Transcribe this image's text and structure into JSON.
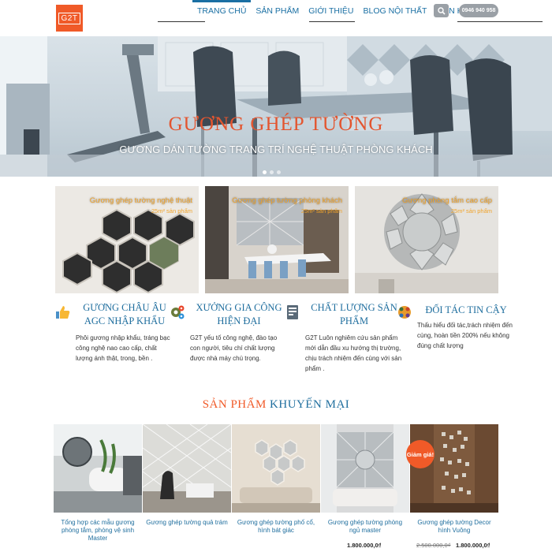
{
  "header": {
    "logo_text": "G2T",
    "nav": [
      {
        "label": "Trang chủ",
        "active": true
      },
      {
        "label": "Sản phẩm",
        "active": false
      },
      {
        "label": "Giới thiệu",
        "active": false
      },
      {
        "label": "Blog nội thất",
        "active": false
      },
      {
        "label": "Liên hệ",
        "active": false
      }
    ],
    "search_icon": "search-icon",
    "phone": "0946 940 958"
  },
  "hero": {
    "title": "GƯƠNG GHÉP TƯỜNG",
    "subtitle": "Gương dán tường trang trí nghệ thuật phòng khách",
    "slides": 3,
    "active_slide": 0
  },
  "tiles": [
    {
      "title": "Gương ghép tường nghệ thuật",
      "subtitle": "25m² sản phẩm"
    },
    {
      "title": "Gương ghép tường phòng khách",
      "subtitle": "25m² sản phẩm"
    },
    {
      "title": "Gương phòng tắm cao cấp",
      "subtitle": "25m² sản phẩm"
    }
  ],
  "features": [
    {
      "icon": "thumbs-up-icon",
      "title": "Gương Châu Âu AGC nhập khẩu",
      "desc": "Phôi gương nhập khẩu, tráng bạc công nghệ nao cao cấp, chất lượng ánh thật, trong, bền ."
    },
    {
      "icon": "factory-icon",
      "title": "Xưởng gia công hiện đại",
      "desc": "G2T yếu tố công nghệ, đào tạo con người, tiêu chí chất lượng được nhà máy chú trọng."
    },
    {
      "icon": "document-icon",
      "title": "Chất lượng sản phẩm",
      "desc": "G2T Luôn nghiêm cứu sản phẩm mới dẫn đầu xu hướng thị trường, chịu trách nhiệm đến cùng với sản phẩm ."
    },
    {
      "icon": "handshake-icon",
      "title": "Đối tác tin cậy",
      "desc": "Thấu hiểu đối tác,trách nhiệm đến cùng, hoàn tiền 200% nếu không đúng chất lượng"
    }
  ],
  "promo": {
    "title_accent": "Sản phẩm",
    "title_rest": "Khuyến mại"
  },
  "products": [
    {
      "name": "Tổng hợp các mẫu gương phòng tắm, phòng vệ sinh Master",
      "price": "",
      "old_price": "",
      "badge": ""
    },
    {
      "name": "Gương ghép tường quả trám",
      "price": "",
      "old_price": "",
      "badge": ""
    },
    {
      "name": "Gương ghép tường phố cổ, hình bát giác",
      "price": "",
      "old_price": "",
      "badge": ""
    },
    {
      "name": "Gương ghép tường phòng ngủ master",
      "price": "1.800.000,0₫",
      "old_price": "",
      "badge": ""
    },
    {
      "name": "Gương ghép tường Decor hình Vuông",
      "price": "1.800.000,0₫",
      "old_price": "2.500.000,0₫",
      "badge": "Giảm giá!"
    }
  ],
  "colors": {
    "brand_orange": "#f05a28",
    "brand_blue": "#1f6e9e",
    "tile_title": "#f0a32a",
    "button_gray": "#9aa0a6"
  }
}
